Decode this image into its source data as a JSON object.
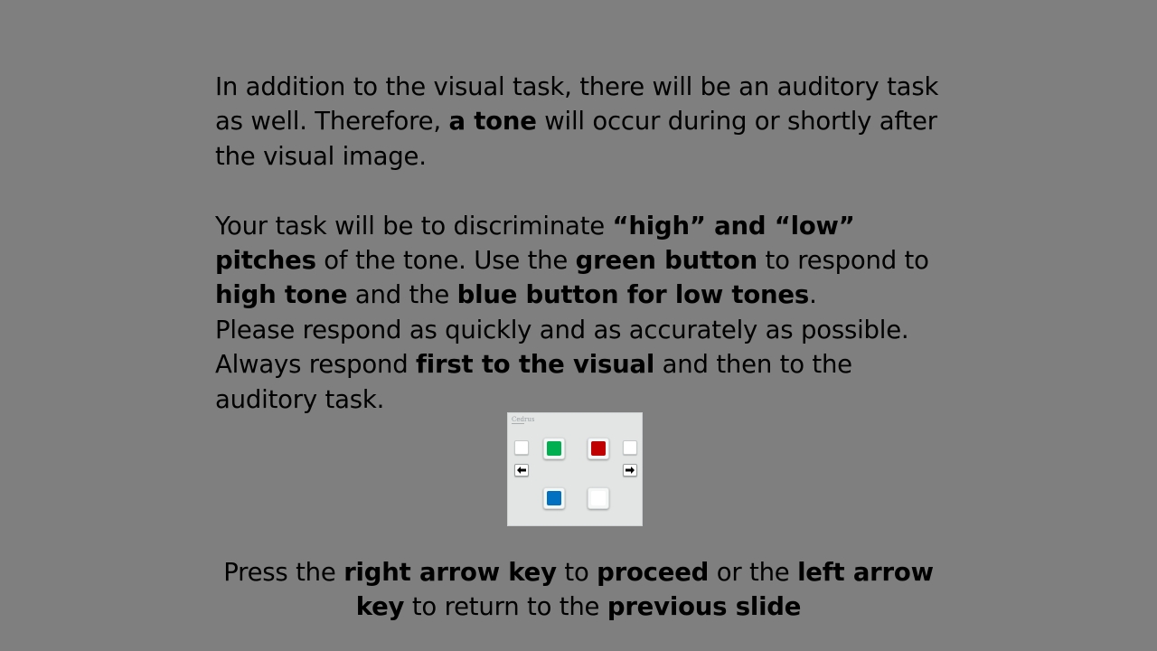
{
  "instructions": {
    "p1": {
      "t1": "In addition to the visual task, there will be an auditory task as well. Therefore, ",
      "b1": "a tone",
      "t2": " will occur during or shortly after the visual image."
    },
    "p2": {
      "t1": "Your task will be to discriminate ",
      "b1": "“high” and “low” pitches",
      "t2": " of the tone. Use the ",
      "b2": "green button",
      "t3": " to respond to ",
      "b3": "high tone",
      "t4": " and the ",
      "b4": "blue button for low tones",
      "t5": "."
    },
    "p3": {
      "t1": "Please respond as quickly and as accurately as possible."
    },
    "p4": {
      "t1": "Always respond ",
      "b1": "first to the visual",
      "t2": " and then to the auditory task."
    }
  },
  "device": {
    "logo": "Cedrus",
    "icons": {
      "left_arrow": "left-arrow-icon",
      "right_arrow": "right-arrow-icon"
    },
    "colors": {
      "green": "#00b050",
      "red": "#c00000",
      "blue": "#0070c0",
      "white": "#ffffff"
    }
  },
  "footer": {
    "t1": "Press the ",
    "b1": "right arrow key",
    "t2": " to ",
    "b2": "proceed",
    "t3": " or the ",
    "b3": "left arrow key",
    "t4": " to return to the ",
    "b4": "previous slide"
  },
  "colors": {
    "background": "#7f7f7f",
    "text": "#000000"
  }
}
